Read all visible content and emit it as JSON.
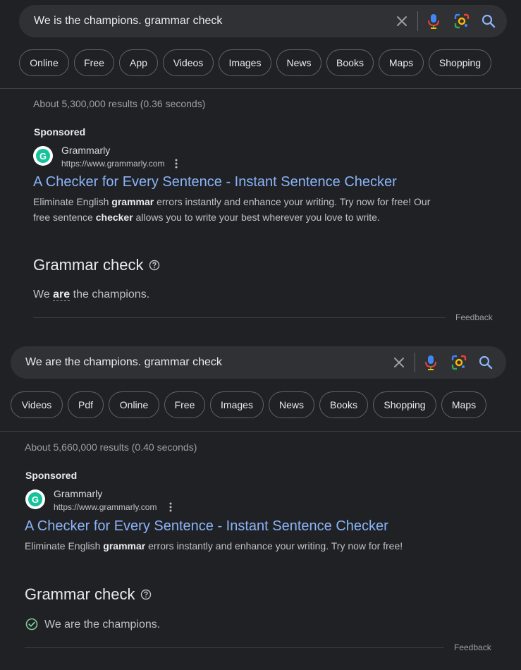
{
  "panel1": {
    "query": "We is the champions. grammar check",
    "chips": [
      "Online",
      "Free",
      "App",
      "Videos",
      "Images",
      "News",
      "Books",
      "Maps",
      "Shopping"
    ],
    "result_stats": "About 5,300,000 results (0.36 seconds)",
    "ad": {
      "sponsored": "Sponsored",
      "favicon_letter": "G",
      "site": "Grammarly",
      "url": "https://www.grammarly.com",
      "title": "A Checker for Every Sentence - Instant Sentence Checker",
      "desc_1": "Eliminate English ",
      "desc_bold_1": "grammar",
      "desc_2": " errors instantly and enhance your writing. Try now for free! Our free sentence ",
      "desc_bold_2": "checker",
      "desc_3": " allows you to write your best wherever you love to write."
    },
    "grammar": {
      "heading": "Grammar check",
      "pre": "We ",
      "fix": "are",
      "post": " the champions.",
      "feedback": "Feedback"
    }
  },
  "panel2": {
    "query": "We are the champions. grammar check",
    "chips": [
      "Videos",
      "Pdf",
      "Online",
      "Free",
      "Images",
      "News",
      "Books",
      "Shopping",
      "Maps"
    ],
    "result_stats": "About 5,660,000 results (0.40 seconds)",
    "ad": {
      "sponsored": "Sponsored",
      "favicon_letter": "G",
      "site": "Grammarly",
      "url": "https://www.grammarly.com",
      "title": "A Checker for Every Sentence - Instant Sentence Checker",
      "desc_1": "Eliminate English ",
      "desc_bold_1": "grammar",
      "desc_2": " errors instantly and enhance your writing. Try now for free!"
    },
    "grammar": {
      "heading": "Grammar check",
      "sentence": "We are the champions.",
      "feedback": "Feedback"
    }
  },
  "icons": [
    "close-icon",
    "microphone-icon",
    "lens-icon",
    "search-icon",
    "kebab-menu-icon",
    "help-icon",
    "check-circle-icon"
  ],
  "colors": {
    "background": "#202124",
    "link": "#8ab4f8",
    "success": "#81c995",
    "brand": "#15c39a"
  }
}
